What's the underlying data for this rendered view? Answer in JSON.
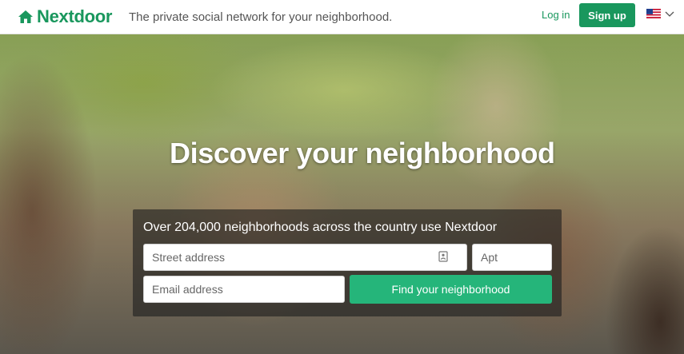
{
  "header": {
    "brand": "Nextdoor",
    "tagline": "The private social network for your neighborhood.",
    "login_label": "Log in",
    "signup_label": "Sign up",
    "locale_icon": "us-flag-icon",
    "locale_chevron": "chevron-down-icon",
    "brand_color": "#19975d"
  },
  "hero": {
    "title": "Discover your neighborhood",
    "panel": {
      "heading": "Over 204,000 neighborhoods across the country use Nextdoor",
      "street_placeholder": "Street address",
      "street_value": "",
      "street_icon": "contact-card-icon",
      "apt_placeholder": "Apt",
      "apt_value": "",
      "email_placeholder": "Email address",
      "email_value": "",
      "submit_label": "Find your neighborhood",
      "submit_color": "#25b57a"
    }
  }
}
